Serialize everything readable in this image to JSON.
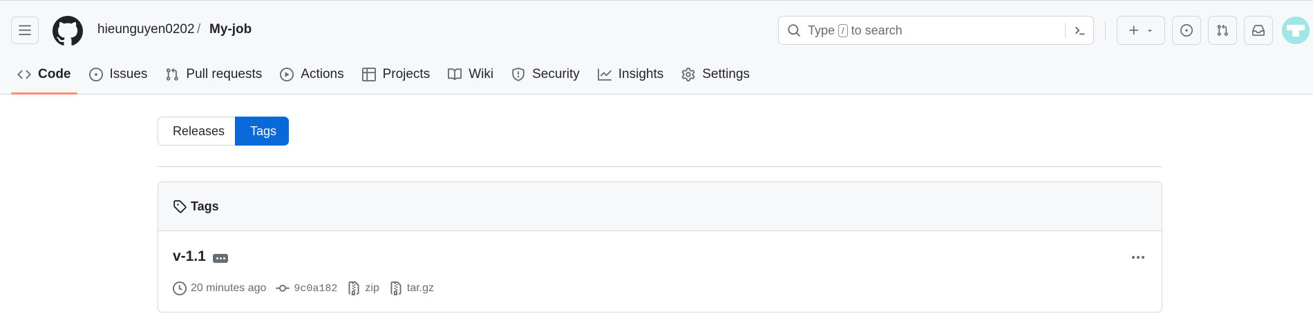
{
  "header": {
    "owner": "hieunguyen0202",
    "separator": "/",
    "repo": "My-job",
    "search": {
      "prefix": "Type",
      "key": "/",
      "suffix": "to search"
    }
  },
  "nav": {
    "tabs": [
      {
        "label": "Code",
        "icon": "code-icon",
        "active": true
      },
      {
        "label": "Issues",
        "icon": "issue-icon"
      },
      {
        "label": "Pull requests",
        "icon": "pull-request-icon"
      },
      {
        "label": "Actions",
        "icon": "play-icon"
      },
      {
        "label": "Projects",
        "icon": "table-icon"
      },
      {
        "label": "Wiki",
        "icon": "book-icon"
      },
      {
        "label": "Security",
        "icon": "shield-icon"
      },
      {
        "label": "Insights",
        "icon": "graph-icon"
      },
      {
        "label": "Settings",
        "icon": "gear-icon"
      }
    ]
  },
  "toggle": {
    "releases": "Releases",
    "tags": "Tags"
  },
  "tags_box": {
    "title": "Tags",
    "items": [
      {
        "name": "v-1.1",
        "time": "20 minutes ago",
        "commit": "9c0a182",
        "zip": "zip",
        "targz": "tar.gz"
      }
    ]
  },
  "colors": {
    "accent": "#0969da",
    "active_underline": "#fd8c73",
    "avatar": "#9fe6e9"
  }
}
